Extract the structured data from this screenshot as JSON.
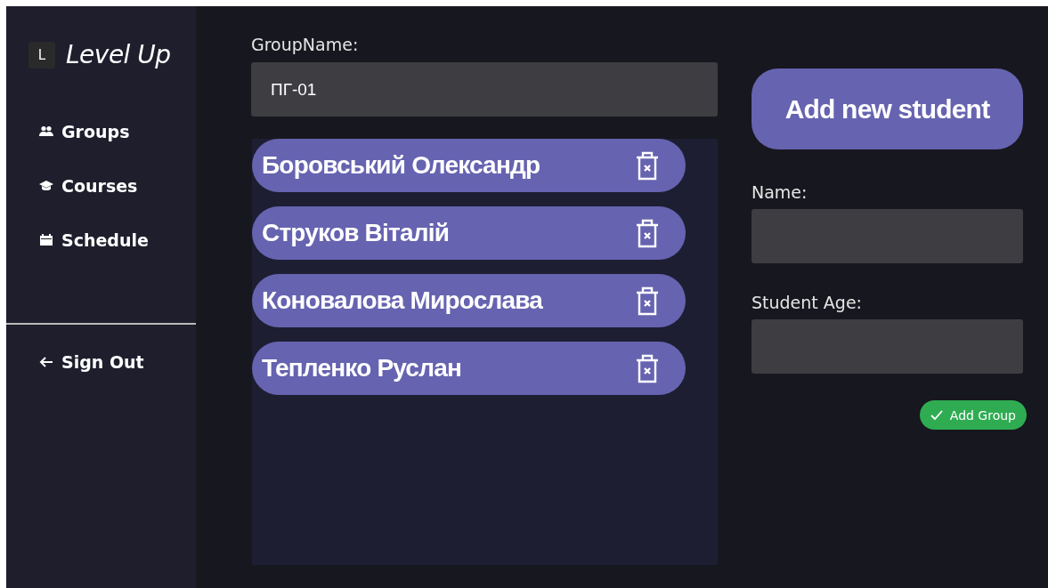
{
  "logo": {
    "letter": "L",
    "title": "Level Up"
  },
  "nav": [
    {
      "kind": "groups",
      "label": "Groups"
    },
    {
      "kind": "courses",
      "label": "Courses"
    },
    {
      "kind": "schedule",
      "label": "Schedule"
    }
  ],
  "sign_out": {
    "label": "Sign Out"
  },
  "group_name": {
    "label": "GroupName:",
    "value": "ПГ-01"
  },
  "students": [
    {
      "name": "Боровський Олександр"
    },
    {
      "name": "Струков Віталій"
    },
    {
      "name": "Коновалова Мирослава"
    },
    {
      "name": "Тепленко Руслан"
    }
  ],
  "add_student_button": "Add new student",
  "name_field": {
    "label": "Name:"
  },
  "age_field": {
    "label": "Student Age:"
  },
  "add_group_button": "Add Group"
}
